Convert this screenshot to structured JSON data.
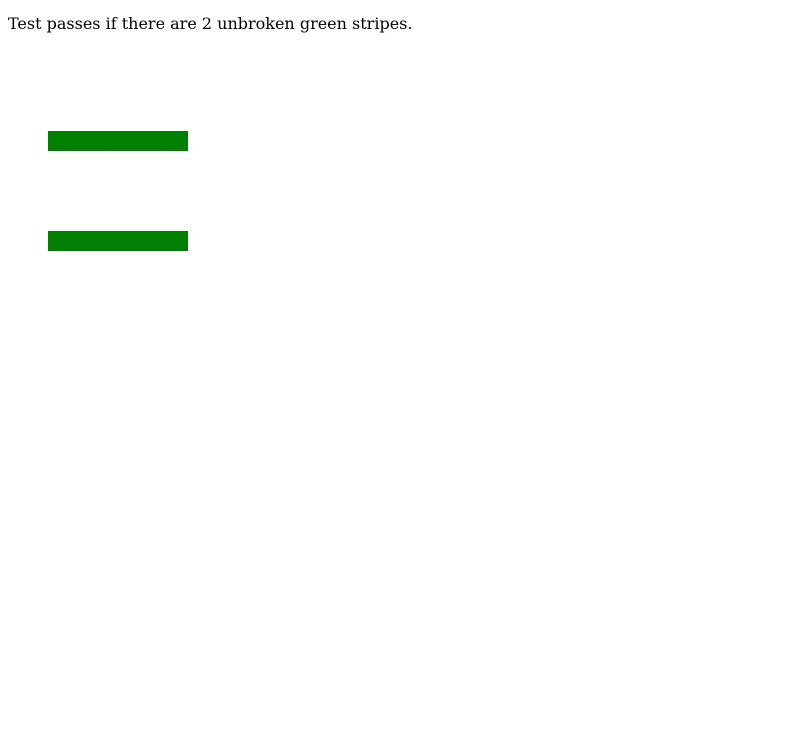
{
  "instruction_text": "Test passes if there are 2 unbroken green stripes.",
  "stripe_color": "#008000",
  "stripes": [
    {
      "name": "stripe-1"
    },
    {
      "name": "stripe-2"
    }
  ]
}
